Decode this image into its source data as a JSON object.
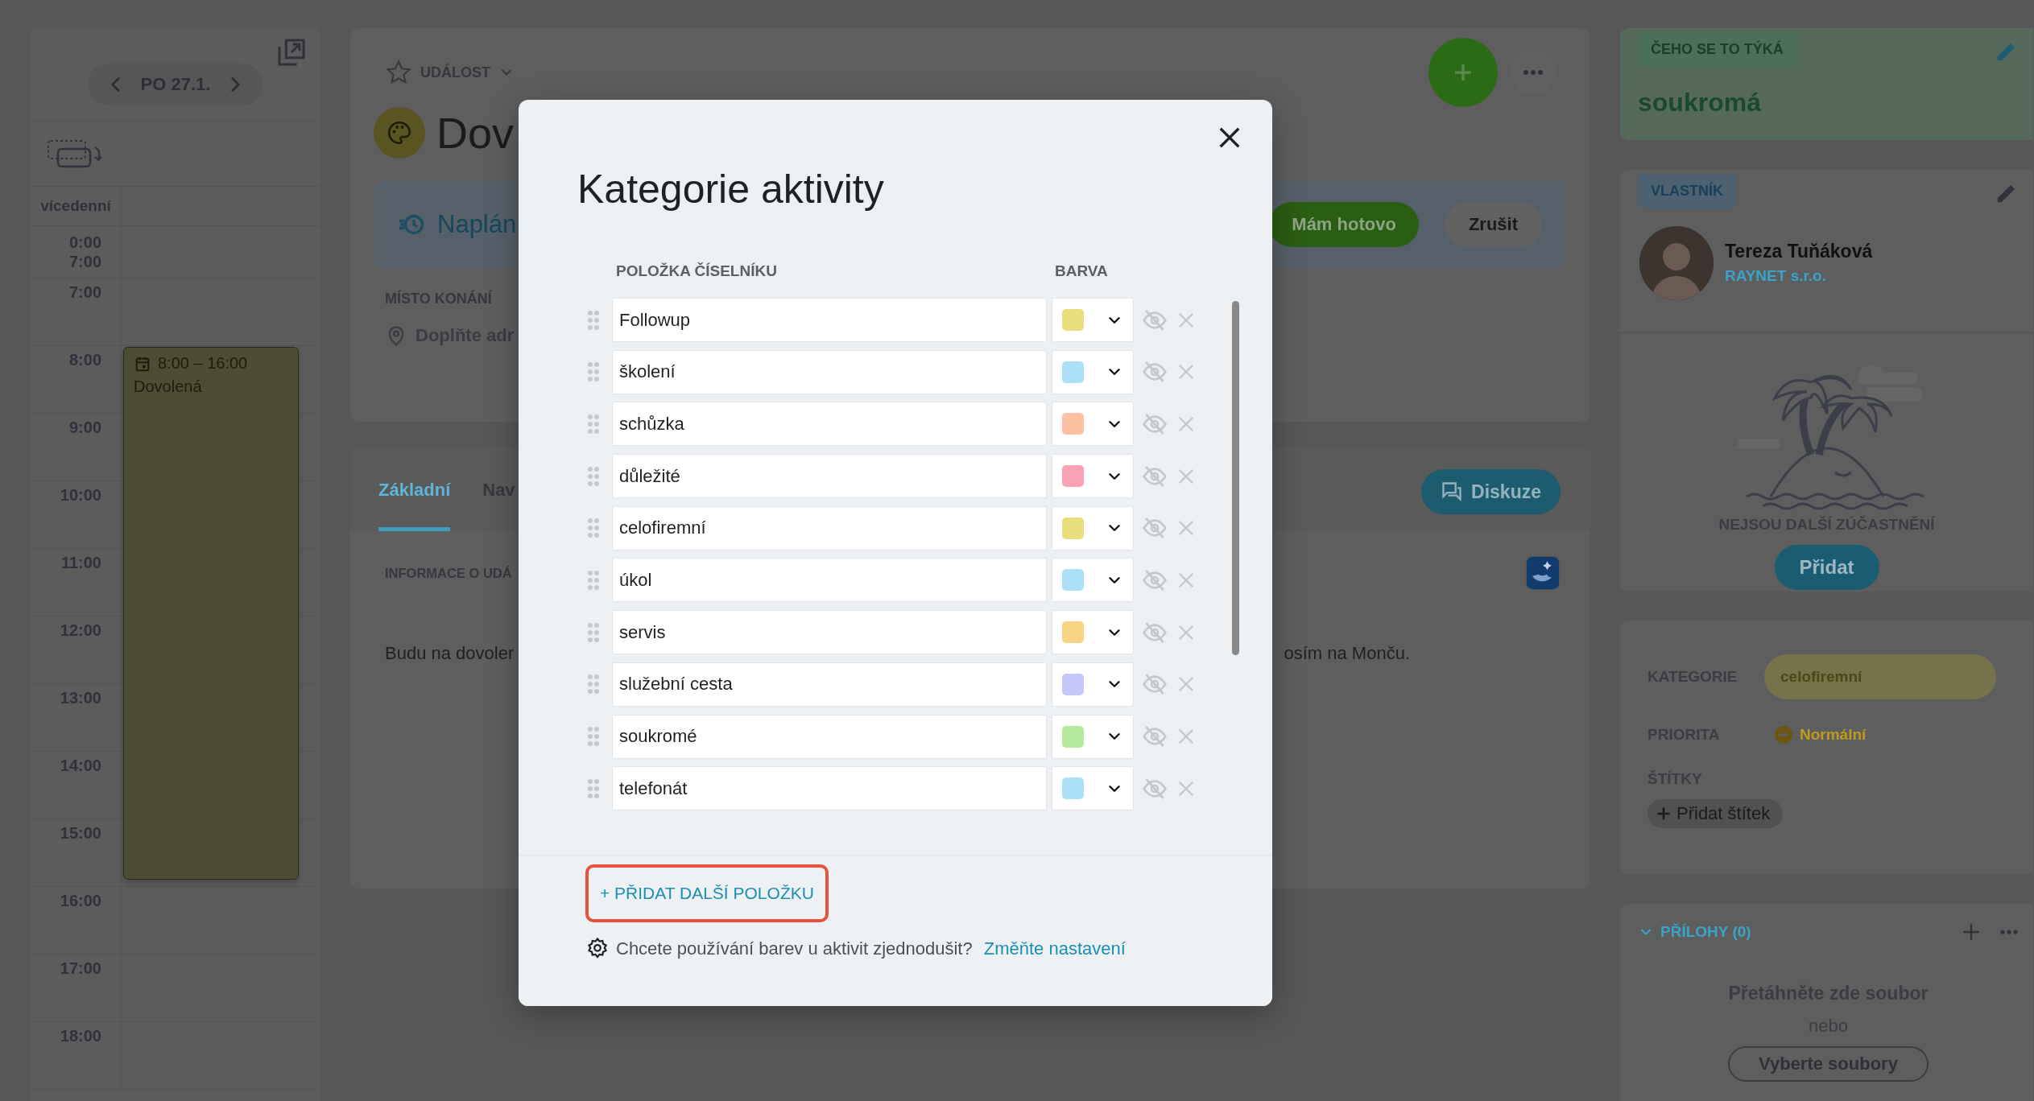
{
  "calendar": {
    "date": "PO 27.1.",
    "all_day_label": "vícedenní",
    "collapsed_range": [
      "0:00",
      "7:00"
    ],
    "hours": [
      "7:00",
      "8:00",
      "9:00",
      "10:00",
      "11:00",
      "12:00",
      "13:00",
      "14:00",
      "15:00",
      "16:00",
      "17:00",
      "18:00"
    ],
    "event": {
      "time": "8:00 – 16:00",
      "title": "Dovolená"
    }
  },
  "activity": {
    "type": "UDÁLOST",
    "title": "Dov",
    "status": "Naplán",
    "buttons": [
      "Mám hotovo",
      "Zrušit"
    ],
    "location_label": "MÍSTO KONÁNÍ",
    "location_placeholder": "Doplňte adr",
    "tabs": [
      {
        "label": "Základní",
        "selected": true
      },
      {
        "label": "Nav",
        "selected": false
      }
    ],
    "discuss_button": "Diskuze",
    "info_label": "INFORMACE O UDÁ",
    "description_start": "Budu na dovoler",
    "description_end": "osím na Monču."
  },
  "sidebar": {
    "subject_label": "ČEHO SE TO TÝKÁ",
    "subject": "soukromá",
    "owner_label": "VLASTNÍK",
    "owner_name": "Tereza Tuňáková",
    "owner_company": "RAYNET s.r.o.",
    "participants_empty": "NEJSOU DALŠÍ ZÚČASTNĚNÍ",
    "add_participant": "Přidat",
    "fields": [
      {
        "label": "KATEGORIE",
        "value": "celofiremní"
      },
      {
        "label": "PRIORITA",
        "value": "Normální"
      }
    ],
    "tags_label": "ŠTÍTKY",
    "add_tag": "Přidat štítek",
    "attachments": {
      "title": "PŘÍLOHY (0)",
      "expanded": true,
      "drop_text": "Přetáhněte zde soubor",
      "or": "nebo",
      "choose": "Vyberte soubory"
    }
  },
  "modal": {
    "title": "Kategorie aktivity",
    "columns": [
      "POLOŽKA ČÍSELNÍKU",
      "BARVA"
    ],
    "items": [
      {
        "name": "Followup",
        "color": "#e8de7c"
      },
      {
        "name": "školení",
        "color": "#acdff8"
      },
      {
        "name": "schůzka",
        "color": "#fcc0a2"
      },
      {
        "name": "důležité",
        "color": "#f8a3b5"
      },
      {
        "name": "celofiremní",
        "color": "#e8de7c"
      },
      {
        "name": "úkol",
        "color": "#acdff8"
      },
      {
        "name": "servis",
        "color": "#f7d482"
      },
      {
        "name": "služební cesta",
        "color": "#c6c7f8"
      },
      {
        "name": "soukromé",
        "color": "#b5e99c"
      },
      {
        "name": "telefonát",
        "color": "#acdff8"
      }
    ],
    "add_button": "+ PŘIDAT DALŠÍ POLOŽKU",
    "hint": "Chcete používání barev u aktivit zjednodušit?",
    "hint_link": "Změňte nastavení"
  }
}
